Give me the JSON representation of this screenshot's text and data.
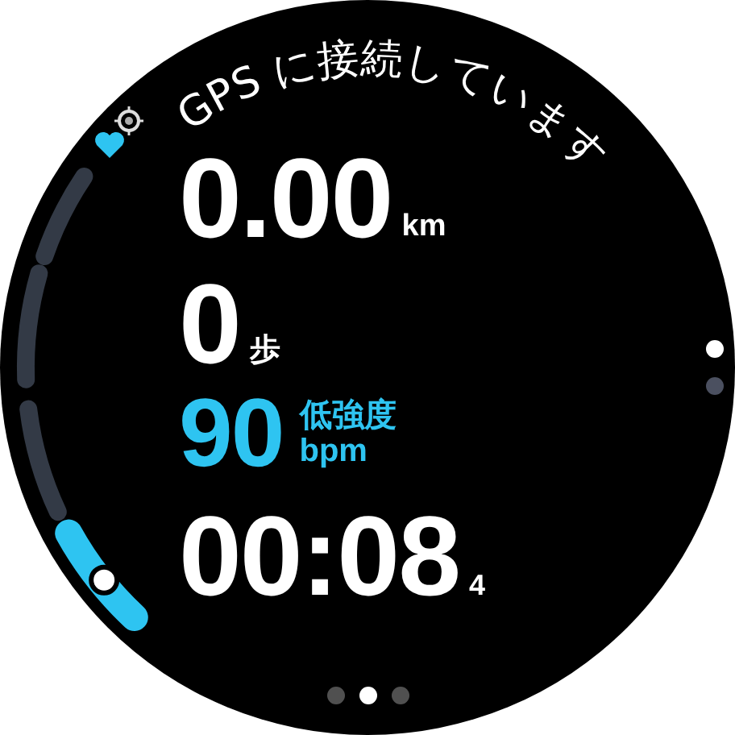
{
  "status": {
    "text": "GPS に接続しています"
  },
  "hr_zones": [
    {
      "selected": false
    },
    {
      "selected": false
    },
    {
      "selected": false
    },
    {
      "selected": true
    }
  ],
  "metrics": [
    {
      "kind": "distance",
      "value": "0.00",
      "unit": "km"
    },
    {
      "kind": "steps",
      "value": "0",
      "unit": "歩"
    },
    {
      "kind": "heart_rate",
      "value": "90",
      "zone": "低強度",
      "unit": "bpm"
    },
    {
      "kind": "time",
      "value": "00:08",
      "fraction": "4"
    }
  ],
  "pages": [
    {
      "selected": false
    },
    {
      "selected": true
    },
    {
      "selected": false
    }
  ],
  "scroll": [
    {
      "selected": true
    },
    {
      "selected": false
    }
  ]
}
